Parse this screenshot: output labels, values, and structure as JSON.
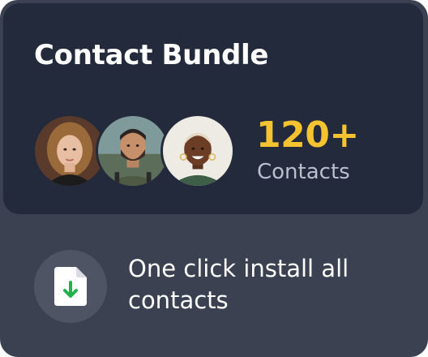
{
  "card": {
    "title": "Contact Bundle",
    "contacts_count": "120+",
    "contacts_label": "Contacts",
    "install_text": "One click install all contacts"
  },
  "colors": {
    "card_background": "#3b4150",
    "top_panel_background": "#232a3b",
    "accent_yellow": "#f5c230",
    "download_green": "#22b24c"
  },
  "icons": {
    "install_icon": "file-download-icon"
  }
}
